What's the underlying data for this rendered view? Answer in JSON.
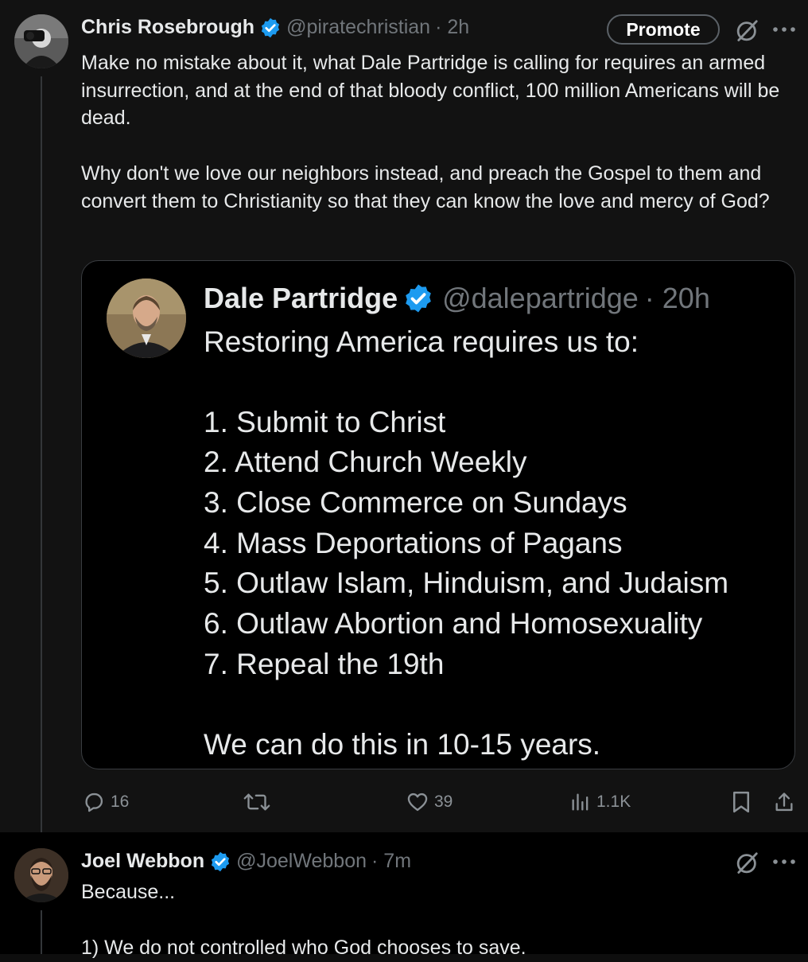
{
  "tweet1": {
    "author_name": "Chris Rosebrough",
    "handle": "@piratechristian",
    "time": "· 2h",
    "promote_label": "Promote",
    "paragraphs": [
      "Make no mistake about it, what Dale Partridge is calling for requires an armed insurrection, and at the end of that bloody conflict, 100 million Americans will be dead.",
      "Why don't we love our neighbors instead, and preach the Gospel to them and convert them to Christianity so that they can know the love and mercy of God?"
    ],
    "quoted": {
      "author_name": "Dale Partridge",
      "handle": "@dalepartridge",
      "time": "· 20h",
      "intro": "Restoring America requires us to:",
      "items": [
        "1. Submit to Christ",
        "2. Attend Church Weekly",
        "3. Close Commerce on Sundays",
        "4. Mass Deportations of Pagans",
        "5. Outlaw Islam, Hinduism, and Judaism",
        "6. Outlaw Abortion and Homosexuality",
        "7. Repeal the 19th"
      ],
      "closing": "We can do this in 10-15 years."
    },
    "actions": {
      "replies": "16",
      "likes": "39",
      "views": "1.1K"
    }
  },
  "tweet2": {
    "author_name": "Joel Webbon",
    "handle": "@JoelWebbon",
    "time": "· 7m",
    "line1": "Because...",
    "line2": "1) We do not controlled who God chooses to save."
  },
  "colors": {
    "verified": "#1d9bf0",
    "muted": "#71767b",
    "text": "#e7e9ea",
    "border": "#3a3d41"
  },
  "icons": [
    "verified-badge-icon",
    "grok-icon",
    "more-icon",
    "reply-icon",
    "retweet-icon",
    "like-icon",
    "views-icon",
    "bookmark-icon",
    "share-icon"
  ]
}
